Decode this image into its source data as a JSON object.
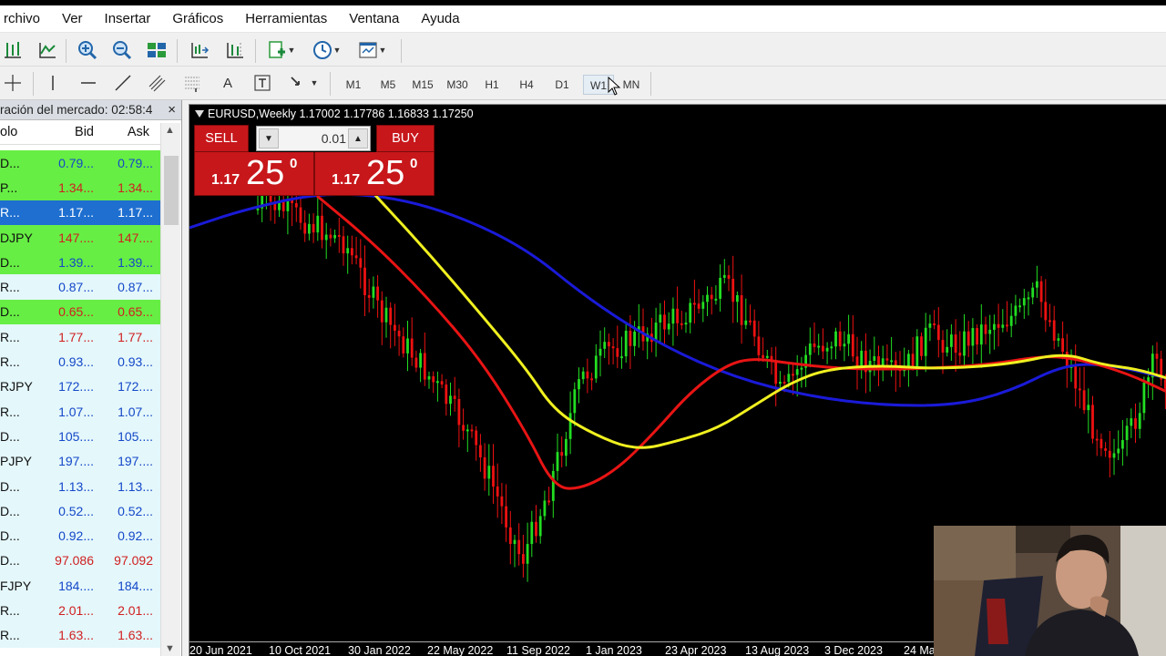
{
  "menu": [
    "rchivo",
    "Ver",
    "Insertar",
    "Gráficos",
    "Herramientas",
    "Ventana",
    "Ayuda"
  ],
  "toolbar": {
    "timeframes": [
      "M1",
      "M5",
      "M15",
      "M30",
      "H1",
      "H4",
      "D1",
      "W1",
      "MN"
    ],
    "active_timeframe": "W1"
  },
  "market_watch": {
    "title": "ración del mercado: 02:58:4",
    "columns": {
      "symbol": "olo",
      "bid": "Bid",
      "ask": "Ask"
    },
    "rows": [
      {
        "symbol": "D...",
        "bid": "0.79...",
        "ask": "0.79...",
        "bg": "#66ee44",
        "color": "#1448c8"
      },
      {
        "symbol": "P...",
        "bid": "1.34...",
        "ask": "1.34...",
        "bg": "#66ee44",
        "color": "#d02020"
      },
      {
        "symbol": "R...",
        "bid": "1.17...",
        "ask": "1.17...",
        "bg": "#1e6fd0",
        "color": "#ffffff"
      },
      {
        "symbol": "DJPY",
        "bid": "147....",
        "ask": "147....",
        "bg": "#66ee44",
        "color": "#d02020"
      },
      {
        "symbol": "D...",
        "bid": "1.39...",
        "ask": "1.39...",
        "bg": "#66ee44",
        "color": "#1448c8"
      },
      {
        "symbol": "R...",
        "bid": "0.87...",
        "ask": "0.87...",
        "bg": "#e4f7fb",
        "color": "#1448c8"
      },
      {
        "symbol": "D...",
        "bid": "0.65...",
        "ask": "0.65...",
        "bg": "#66ee44",
        "color": "#d02020"
      },
      {
        "symbol": "R...",
        "bid": "1.77...",
        "ask": "1.77...",
        "bg": "#e4f7fb",
        "color": "#d02020"
      },
      {
        "symbol": "R...",
        "bid": "0.93...",
        "ask": "0.93...",
        "bg": "#e4f7fb",
        "color": "#1448c8"
      },
      {
        "symbol": "RJPY",
        "bid": "172....",
        "ask": "172....",
        "bg": "#e4f7fb",
        "color": "#1448c8"
      },
      {
        "symbol": "R...",
        "bid": "1.07...",
        "ask": "1.07...",
        "bg": "#e4f7fb",
        "color": "#1448c8"
      },
      {
        "symbol": "D...",
        "bid": "105....",
        "ask": "105....",
        "bg": "#e4f7fb",
        "color": "#1448c8"
      },
      {
        "symbol": "PJPY",
        "bid": "197....",
        "ask": "197....",
        "bg": "#e4f7fb",
        "color": "#1448c8"
      },
      {
        "symbol": "D...",
        "bid": "1.13...",
        "ask": "1.13...",
        "bg": "#e4f7fb",
        "color": "#1448c8"
      },
      {
        "symbol": "D...",
        "bid": "0.52...",
        "ask": "0.52...",
        "bg": "#e4f7fb",
        "color": "#1448c8"
      },
      {
        "symbol": "D...",
        "bid": "0.92...",
        "ask": "0.92...",
        "bg": "#e4f7fb",
        "color": "#1448c8"
      },
      {
        "symbol": "D...",
        "bid": "97.086",
        "ask": "97.092",
        "bg": "#e4f7fb",
        "color": "#d02020"
      },
      {
        "symbol": "FJPY",
        "bid": "184....",
        "ask": "184....",
        "bg": "#e4f7fb",
        "color": "#1448c8"
      },
      {
        "symbol": "R...",
        "bid": "2.01...",
        "ask": "2.01...",
        "bg": "#e4f7fb",
        "color": "#d02020"
      },
      {
        "symbol": "R...",
        "bid": "1.63...",
        "ask": "1.63...",
        "bg": "#e4f7fb",
        "color": "#d02020"
      }
    ]
  },
  "chart": {
    "title": "EURUSD,Weekly  1.17002 1.17786 1.16833 1.17250",
    "sell_label": "SELL",
    "buy_label": "BUY",
    "lot": "0.01",
    "sell_price": {
      "small": "1.17",
      "big": "25",
      "sup": "0"
    },
    "buy_price": {
      "small": "1.17",
      "big": "25",
      "sup": "0"
    },
    "x_labels": [
      "20 Jun 2021",
      "10 Oct 2021",
      "30 Jan 2022",
      "22 May 2022",
      "11 Sep 2022",
      "1 Jan 2023",
      "23 Apr 2023",
      "13 Aug 2023",
      "3 Dec 2023",
      "24 Ma"
    ]
  },
  "chart_data": {
    "type": "candlestick",
    "series": [
      {
        "name": "",
        "color": "#1a1ad8",
        "style": "moving-average"
      },
      {
        "name": "",
        "color": "#e81414",
        "style": "moving-average"
      },
      {
        "name": "",
        "color": "#f0f020",
        "style": "moving-average"
      }
    ],
    "up_color": "#22dd22",
    "down_color": "#ee1111"
  }
}
